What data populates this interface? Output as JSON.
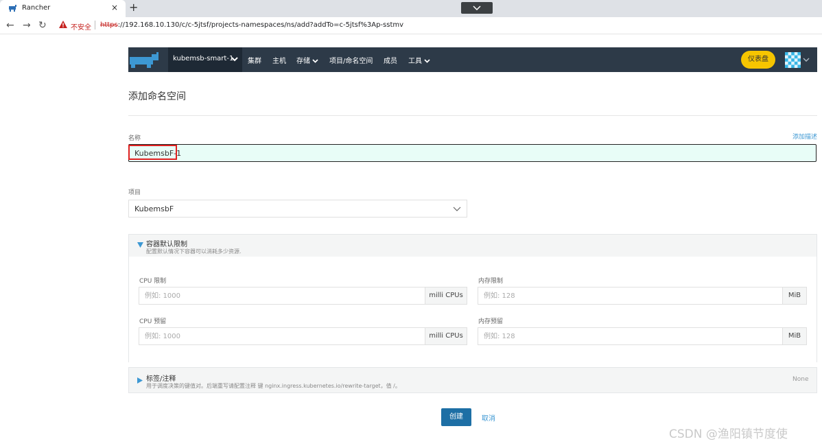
{
  "browser": {
    "tab_title": "Rancher",
    "tab_close": "×",
    "new_tab": "+",
    "security_label": "不安全",
    "url_scheme": "https",
    "url_rest": "://192.168.10.130/c/c-5jtsf/projects-namespaces/ns/add?addTo=c-5jtsf%3Ap-sstmv",
    "back": "←",
    "forward": "→",
    "reload": "↻"
  },
  "header": {
    "cluster_name": "kubemsb-smart-1",
    "nav": {
      "cluster": "集群",
      "hosts": "主机",
      "storage": "存储",
      "projects": "项目/命名空间",
      "members": "成员",
      "tools": "工具"
    },
    "dashboard_button": "仪表盘",
    "brand_color": "#2d3a48",
    "dashboard_color": "#f6c500"
  },
  "page": {
    "title": "添加命名空间",
    "name_label": "名称",
    "add_description": "添加描述",
    "name_value": "KubemsbF-1",
    "project_label": "项目",
    "project_value": "KubemsbF"
  },
  "limits": {
    "title": "容器默认限制",
    "subtitle": "配置默认情况下容器可以消耗多少资源.",
    "cpu_limit_label": "CPU 限制",
    "cpu_limit_placeholder": "例如: 1000",
    "cpu_limit_unit": "milli CPUs",
    "mem_limit_label": "内存限制",
    "mem_limit_placeholder": "例如: 128",
    "mem_limit_unit": "MiB",
    "cpu_reserve_label": "CPU 预留",
    "cpu_reserve_placeholder": "例如: 1000",
    "cpu_reserve_unit": "milli CPUs",
    "mem_reserve_label": "内存预留",
    "mem_reserve_placeholder": "例如: 128",
    "mem_reserve_unit": "MiB"
  },
  "labels": {
    "title": "标签/注释",
    "subtitle": "用于调度决策的键值对。后端重写请配置注释 键 nginx.ingress.kubernetes.io/rewrite-target，值 /。",
    "status": "None"
  },
  "actions": {
    "create": "创建",
    "cancel": "取消"
  },
  "watermark": "CSDN @渔阳镇节度使"
}
